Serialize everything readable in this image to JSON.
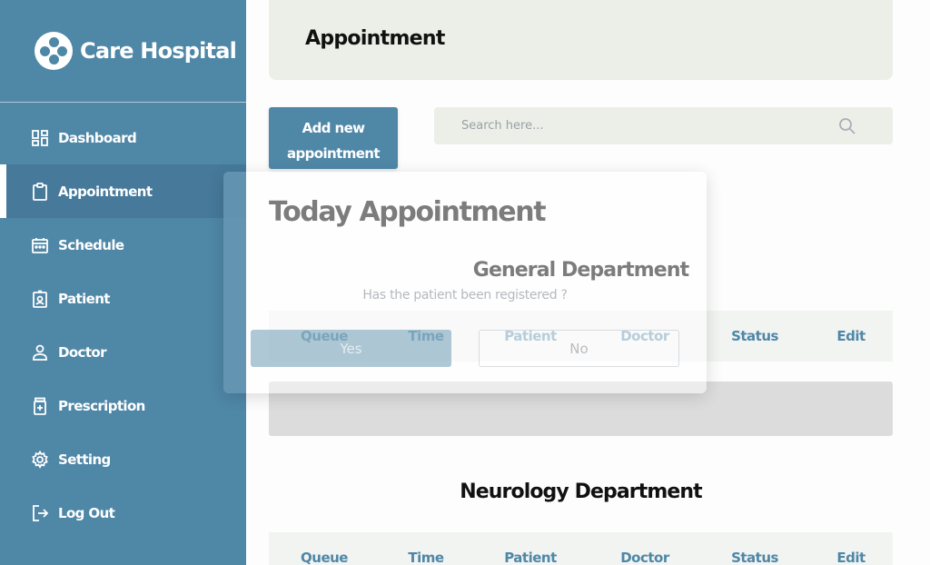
{
  "brand": {
    "name": "Care Hospital",
    "logo_icon": "hospital-logo-icon",
    "color": "#4f87a7"
  },
  "sidebar": {
    "items": [
      {
        "label": "Dashboard",
        "icon": "dashboard-icon",
        "active": false
      },
      {
        "label": "Appointment",
        "icon": "clipboard-icon",
        "active": true
      },
      {
        "label": "Schedule",
        "icon": "calendar-icon",
        "active": false
      },
      {
        "label": "Patient",
        "icon": "patient-badge-icon",
        "active": false
      },
      {
        "label": "Doctor",
        "icon": "user-icon",
        "active": false
      },
      {
        "label": "Prescription",
        "icon": "prescription-icon",
        "active": false
      },
      {
        "label": "Setting",
        "icon": "gear-icon",
        "active": false
      },
      {
        "label": "Log Out",
        "icon": "logout-icon",
        "active": false
      }
    ]
  },
  "header": {
    "title": "Appointment"
  },
  "toolbar": {
    "add_line1": "Add new",
    "add_line2": "appointment",
    "search_placeholder": "Search here...",
    "search_icon": "search-icon"
  },
  "section": {
    "title": "Today Appointment"
  },
  "departments": [
    {
      "title": "General Department",
      "columns": [
        "Queue",
        "Time",
        "Patient",
        "Doctor",
        "Status",
        "Edit"
      ],
      "rows": []
    },
    {
      "title": "Neurology Department",
      "columns": [
        "Queue",
        "Time",
        "Patient",
        "Doctor",
        "Status",
        "Edit"
      ],
      "rows": []
    }
  ],
  "modal": {
    "question": "Has the patient been registered ?",
    "yes_label": "Yes",
    "no_label": "No"
  },
  "colors": {
    "accent": "#4f87a7",
    "header_bg": "#ebefe8",
    "table_header_bg": "#f2f4f2"
  }
}
